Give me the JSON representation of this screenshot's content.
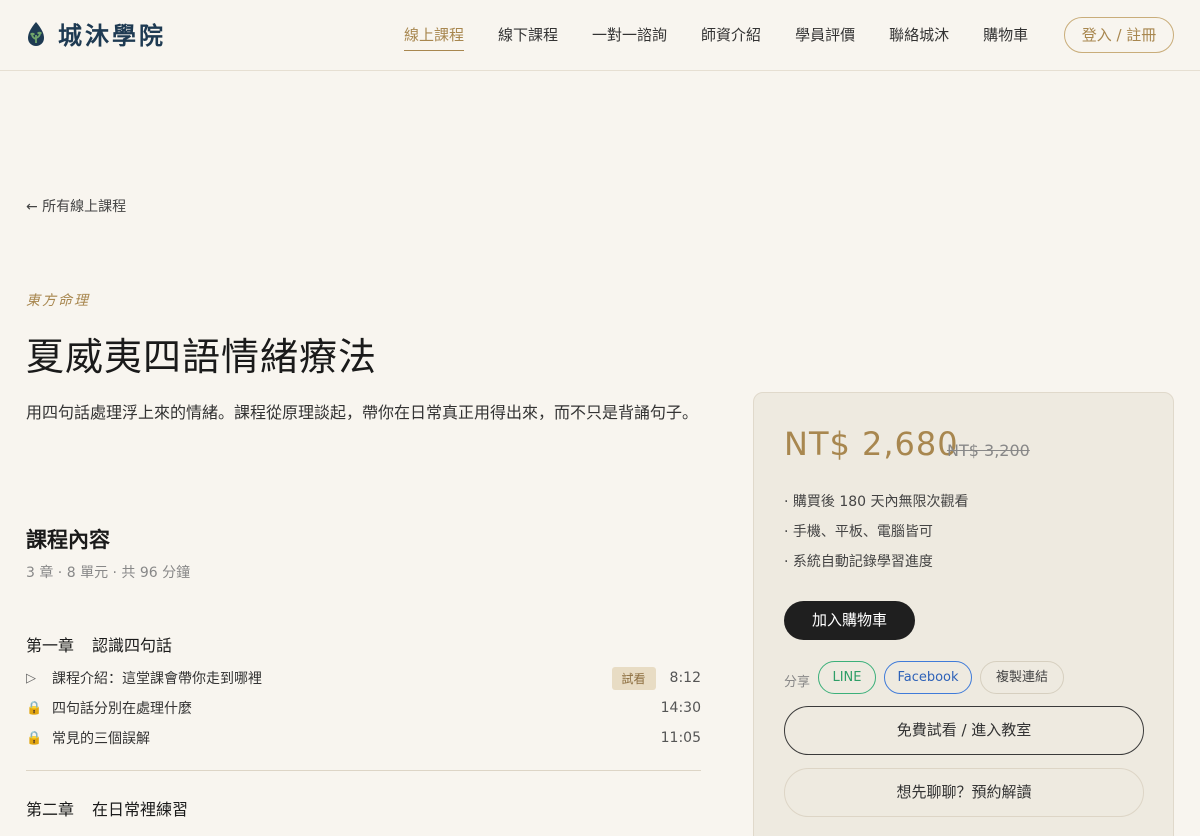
{
  "header": {
    "logo_text": "城沐學院",
    "nav": [
      "線上課程",
      "線下課程",
      "一對一諮詢",
      "師資介紹",
      "學員評價",
      "聯絡城沐",
      "購物車"
    ],
    "active_nav": "線上課程",
    "login_label": "登入 / 註冊",
    "brand_color": "#1e3a52",
    "accent_color": "#a8874f"
  },
  "back_link": "← 所有線上課程",
  "course": {
    "category": "東方命理",
    "title": "夏威夷四語情緒療法",
    "description": "用四句話處理浮上來的情緒。課程從原理談起，帶你在日常真正用得出來，而不只是背誦句子。"
  },
  "content": {
    "section_title": "課程內容",
    "meta": "3 章 · 8 單元 · 共 96 分鐘",
    "chapters": [
      {
        "label": "第一章",
        "title": "認識四句話",
        "lessons": [
          {
            "icon": "play-icon",
            "glyph": "▷",
            "name": "課程介紹：這堂課會帶你走到哪裡",
            "badge": "試看",
            "time": "8:12"
          },
          {
            "icon": "lock-icon",
            "glyph": "🔒",
            "name": "四句話分別在處理什麼",
            "badge": "",
            "time": "14:30"
          },
          {
            "icon": "lock-icon",
            "glyph": "🔒",
            "name": "常見的三個誤解",
            "badge": "",
            "time": "11:05"
          }
        ]
      },
      {
        "label": "第二章",
        "title": "在日常裡練習",
        "lessons": []
      }
    ]
  },
  "purchase": {
    "price": "NT$ 2,680",
    "old_price": "NT$ 3,200",
    "features": [
      "· 購買後 180 天內無限次觀看",
      "· 手機、平板、電腦皆可",
      "· 系統自動記錄學習進度"
    ],
    "cart_label": "加入購物車",
    "share_label": "分享",
    "share_line": "LINE",
    "share_facebook": "Facebook",
    "share_copy": "複製連結",
    "trial_label": "免費試看 / 進入教室",
    "consult_label": "想先聊聊？預約解讀"
  }
}
